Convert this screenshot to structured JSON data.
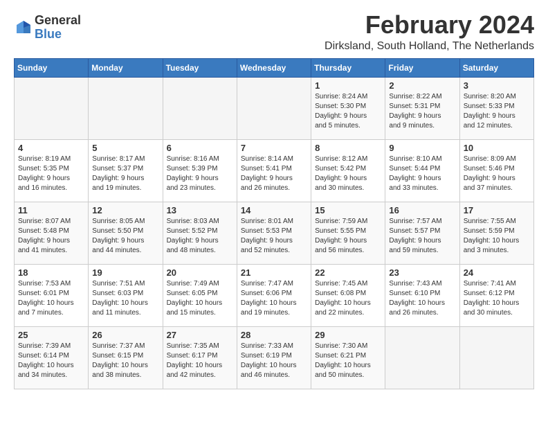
{
  "header": {
    "logo_general": "General",
    "logo_blue": "Blue",
    "title": "February 2024",
    "subtitle": "Dirksland, South Holland, The Netherlands"
  },
  "days_of_week": [
    "Sunday",
    "Monday",
    "Tuesday",
    "Wednesday",
    "Thursday",
    "Friday",
    "Saturday"
  ],
  "weeks": [
    [
      {
        "day": "",
        "info": ""
      },
      {
        "day": "",
        "info": ""
      },
      {
        "day": "",
        "info": ""
      },
      {
        "day": "",
        "info": ""
      },
      {
        "day": "1",
        "info": "Sunrise: 8:24 AM\nSunset: 5:30 PM\nDaylight: 9 hours\nand 5 minutes."
      },
      {
        "day": "2",
        "info": "Sunrise: 8:22 AM\nSunset: 5:31 PM\nDaylight: 9 hours\nand 9 minutes."
      },
      {
        "day": "3",
        "info": "Sunrise: 8:20 AM\nSunset: 5:33 PM\nDaylight: 9 hours\nand 12 minutes."
      }
    ],
    [
      {
        "day": "4",
        "info": "Sunrise: 8:19 AM\nSunset: 5:35 PM\nDaylight: 9 hours\nand 16 minutes."
      },
      {
        "day": "5",
        "info": "Sunrise: 8:17 AM\nSunset: 5:37 PM\nDaylight: 9 hours\nand 19 minutes."
      },
      {
        "day": "6",
        "info": "Sunrise: 8:16 AM\nSunset: 5:39 PM\nDaylight: 9 hours\nand 23 minutes."
      },
      {
        "day": "7",
        "info": "Sunrise: 8:14 AM\nSunset: 5:41 PM\nDaylight: 9 hours\nand 26 minutes."
      },
      {
        "day": "8",
        "info": "Sunrise: 8:12 AM\nSunset: 5:42 PM\nDaylight: 9 hours\nand 30 minutes."
      },
      {
        "day": "9",
        "info": "Sunrise: 8:10 AM\nSunset: 5:44 PM\nDaylight: 9 hours\nand 33 minutes."
      },
      {
        "day": "10",
        "info": "Sunrise: 8:09 AM\nSunset: 5:46 PM\nDaylight: 9 hours\nand 37 minutes."
      }
    ],
    [
      {
        "day": "11",
        "info": "Sunrise: 8:07 AM\nSunset: 5:48 PM\nDaylight: 9 hours\nand 41 minutes."
      },
      {
        "day": "12",
        "info": "Sunrise: 8:05 AM\nSunset: 5:50 PM\nDaylight: 9 hours\nand 44 minutes."
      },
      {
        "day": "13",
        "info": "Sunrise: 8:03 AM\nSunset: 5:52 PM\nDaylight: 9 hours\nand 48 minutes."
      },
      {
        "day": "14",
        "info": "Sunrise: 8:01 AM\nSunset: 5:53 PM\nDaylight: 9 hours\nand 52 minutes."
      },
      {
        "day": "15",
        "info": "Sunrise: 7:59 AM\nSunset: 5:55 PM\nDaylight: 9 hours\nand 56 minutes."
      },
      {
        "day": "16",
        "info": "Sunrise: 7:57 AM\nSunset: 5:57 PM\nDaylight: 9 hours\nand 59 minutes."
      },
      {
        "day": "17",
        "info": "Sunrise: 7:55 AM\nSunset: 5:59 PM\nDaylight: 10 hours\nand 3 minutes."
      }
    ],
    [
      {
        "day": "18",
        "info": "Sunrise: 7:53 AM\nSunset: 6:01 PM\nDaylight: 10 hours\nand 7 minutes."
      },
      {
        "day": "19",
        "info": "Sunrise: 7:51 AM\nSunset: 6:03 PM\nDaylight: 10 hours\nand 11 minutes."
      },
      {
        "day": "20",
        "info": "Sunrise: 7:49 AM\nSunset: 6:05 PM\nDaylight: 10 hours\nand 15 minutes."
      },
      {
        "day": "21",
        "info": "Sunrise: 7:47 AM\nSunset: 6:06 PM\nDaylight: 10 hours\nand 19 minutes."
      },
      {
        "day": "22",
        "info": "Sunrise: 7:45 AM\nSunset: 6:08 PM\nDaylight: 10 hours\nand 22 minutes."
      },
      {
        "day": "23",
        "info": "Sunrise: 7:43 AM\nSunset: 6:10 PM\nDaylight: 10 hours\nand 26 minutes."
      },
      {
        "day": "24",
        "info": "Sunrise: 7:41 AM\nSunset: 6:12 PM\nDaylight: 10 hours\nand 30 minutes."
      }
    ],
    [
      {
        "day": "25",
        "info": "Sunrise: 7:39 AM\nSunset: 6:14 PM\nDaylight: 10 hours\nand 34 minutes."
      },
      {
        "day": "26",
        "info": "Sunrise: 7:37 AM\nSunset: 6:15 PM\nDaylight: 10 hours\nand 38 minutes."
      },
      {
        "day": "27",
        "info": "Sunrise: 7:35 AM\nSunset: 6:17 PM\nDaylight: 10 hours\nand 42 minutes."
      },
      {
        "day": "28",
        "info": "Sunrise: 7:33 AM\nSunset: 6:19 PM\nDaylight: 10 hours\nand 46 minutes."
      },
      {
        "day": "29",
        "info": "Sunrise: 7:30 AM\nSunset: 6:21 PM\nDaylight: 10 hours\nand 50 minutes."
      },
      {
        "day": "",
        "info": ""
      },
      {
        "day": "",
        "info": ""
      }
    ]
  ]
}
